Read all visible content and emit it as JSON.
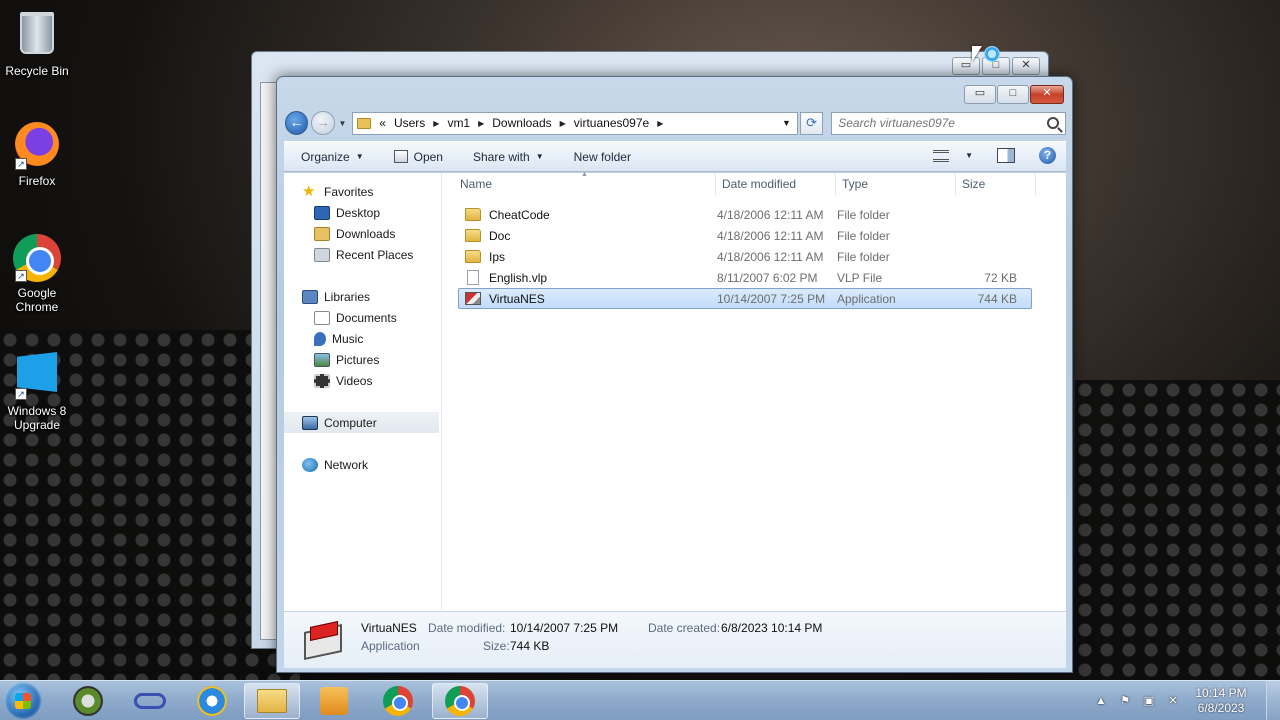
{
  "desktop": {
    "icons": [
      {
        "label": "Recycle Bin",
        "icon": "recycle-bin-icon"
      },
      {
        "label": "Firefox",
        "icon": "firefox-icon"
      },
      {
        "label": "Google Chrome",
        "icon": "chrome-icon"
      },
      {
        "label": "Windows 8 Upgrade",
        "icon": "windows8-icon"
      }
    ]
  },
  "window": {
    "controls": {
      "minimize": "▭",
      "maximize": "□",
      "close": "✕"
    },
    "address": {
      "prefix": "«",
      "crumbs": [
        "Users",
        "vm1",
        "Downloads",
        "virtuanes097e"
      ]
    },
    "search": {
      "placeholder": "Search virtuanes097e"
    },
    "toolbar": {
      "organize": "Organize",
      "open": "Open",
      "share_with": "Share with",
      "new_folder": "New folder"
    },
    "nav_pane": {
      "favorites": "Favorites",
      "favorites_items": [
        "Desktop",
        "Downloads",
        "Recent Places"
      ],
      "libraries": "Libraries",
      "libraries_items": [
        "Documents",
        "Music",
        "Pictures",
        "Videos"
      ],
      "computer": "Computer",
      "network": "Network"
    },
    "columns": {
      "name": "Name",
      "date": "Date modified",
      "type": "Type",
      "size": "Size"
    },
    "files": [
      {
        "name": "CheatCode",
        "date": "4/18/2006 12:11 AM",
        "type": "File folder",
        "size": "",
        "icon": "folder-icon"
      },
      {
        "name": "Doc",
        "date": "4/18/2006 12:11 AM",
        "type": "File folder",
        "size": "",
        "icon": "folder-icon"
      },
      {
        "name": "Ips",
        "date": "4/18/2006 12:11 AM",
        "type": "File folder",
        "size": "",
        "icon": "folder-icon"
      },
      {
        "name": "English.vlp",
        "date": "8/11/2007 6:02 PM",
        "type": "VLP File",
        "size": "72 KB",
        "icon": "file-icon"
      },
      {
        "name": "VirtuaNES",
        "date": "10/14/2007 7:25 PM",
        "type": "Application",
        "size": "744 KB",
        "icon": "app-icon",
        "selected": true
      }
    ],
    "details": {
      "name": "VirtuaNES",
      "type": "Application",
      "date_modified_label": "Date modified:",
      "date_modified": "10/14/2007 7:25 PM",
      "date_created_label": "Date created:",
      "date_created": "6/8/2023 10:14 PM",
      "size_label": "Size:",
      "size": "744 KB"
    }
  },
  "taskbar": {
    "clock_time": "10:14 PM",
    "clock_date": "6/8/2023"
  }
}
